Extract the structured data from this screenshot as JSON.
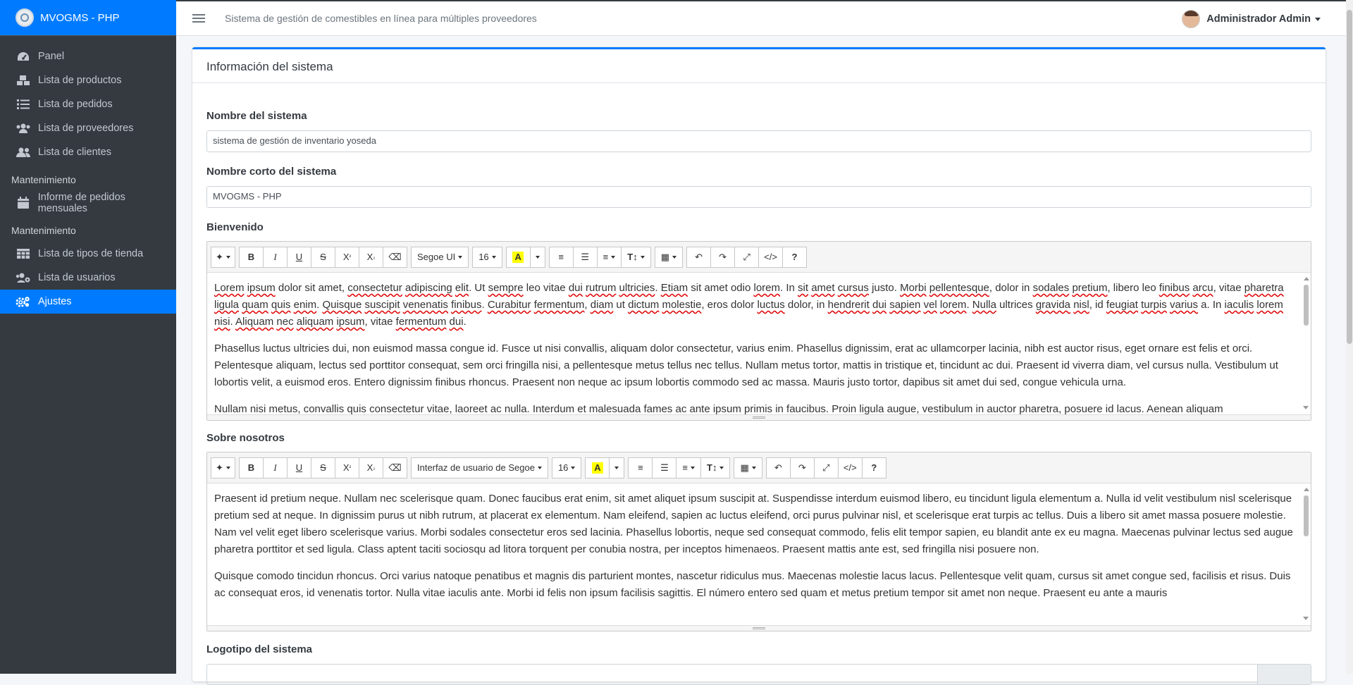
{
  "brand": {
    "title": "MVOGMS - PHP"
  },
  "sidebar": {
    "items": [
      {
        "label": "Panel",
        "icon": "tachometer-icon"
      },
      {
        "label": "Lista de productos",
        "icon": "boxes-icon"
      },
      {
        "label": "Lista de pedidos",
        "icon": "list-icon"
      },
      {
        "label": "Lista de proveedores",
        "icon": "users-icon"
      },
      {
        "label": "Lista de clientes",
        "icon": "user-friends-icon"
      }
    ],
    "header1": "Mantenimiento",
    "report": {
      "label": "Informe de pedidos mensuales",
      "icon": "calendar-icon"
    },
    "header2": "Mantenimiento",
    "items2": [
      {
        "label": "Lista de tipos de tienda",
        "icon": "table-icon"
      },
      {
        "label": "Lista de usuarios",
        "icon": "users-cog-icon"
      },
      {
        "label": "Ajustes",
        "icon": "cogs-icon",
        "active": true
      }
    ]
  },
  "topbar": {
    "system_name": "Sistema de gestión de comestibles en línea para múltiples proveedores",
    "user": "Administrador Admin"
  },
  "card": {
    "title": "Información del sistema"
  },
  "form": {
    "name_label": "Nombre del sistema",
    "name_value": "sistema de gestión de inventario yoseda",
    "short_label": "Nombre corto del sistema",
    "short_value": "MVOGMS - PHP",
    "welcome_label": "Bienvenido",
    "about_label": "Sobre nosotros",
    "logo_label": "Logotipo del sistema"
  },
  "editor1": {
    "font": "Segoe UI",
    "size": "16",
    "paragraphs": [
      "Phasellus luctus ultricies dui, non euismod massa congue id. Fusce ut nisi convallis, aliquam dolor consectetur, varius enim. Phasellus dignissim, erat ac ullamcorper lacinia, nibh est auctor risus, eget ornare est felis et orci. Pelentesque aliquam, lectus sed porttitor consequat, sem orci fringilla nisi, a pellentesque metus tellus nec tellus. Nullam metus tortor, mattis in tristique et, tincidunt ac dui. Praesent id viverra diam, vel cursus nulla. Vestibulum ut lobortis velit, a euismod eros. Entero dignissim finibus rhoncus. Praesent non neque ac ipsum lobortis commodo sed ac massa. Mauris justo tortor, dapibus sit amet dui sed, congue vehicula urna.",
      "Nullam nisi metus, convallis quis consectetur vitae, laoreet ac nulla. Interdum et malesuada fames ac ante ipsum primis in faucibus. Proin ligula augue, vestibulum in auctor pharetra, posuere id lacus. Aenean aliquam"
    ]
  },
  "editor2": {
    "font": "Interfaz de usuario de Segoe",
    "size": "16",
    "paragraphs": [
      "Praesent id pretium neque. Nullam nec scelerisque quam. Donec faucibus erat enim, sit amet aliquet ipsum suscipit at. Suspendisse interdum euismod libero, eu tincidunt ligula elementum a. Nulla id velit vestibulum nisl scelerisque pretium sed at neque. In dignissim purus ut nibh rutrum, at placerat ex elementum. Nam eleifend, sapien ac luctus eleifend, orci purus pulvinar nisl, et scelerisque erat turpis ac tellus. Duis a libero sit amet massa posuere molestie. Nam vel velit eget libero scelerisque varius. Morbi sodales consectetur eros sed lacinia. Phasellus lobortis, neque sed consequat commodo, felis elit tempor sapien, eu blandit ante ex eu magna. Maecenas pulvinar lectus sed augue pharetra porttitor et sed ligula. Class aptent taciti sociosqu ad litora torquent per conubia nostra, per inceptos himenaeos. Praesent mattis ante est, sed fringilla nisi posuere non.",
      "Quisque comodo tincidun rhoncus. Orci varius natoque penatibus et magnis dis parturient montes, nascetur ridiculus mus. Maecenas molestie lacus lacus. Pellentesque velit quam, cursus sit amet congue sed, facilisis et risus. Duis ac consequat eros, id venenatis tortor. Nulla vitae iaculis ante. Morbi id felis non ipsum facilisis sagittis. El número entero sed quam et metus pretium tempor sit amet non neque. Praesent eu ante a mauris"
    ]
  },
  "colors": {
    "primary": "#007bff",
    "sidebar": "#343a40"
  }
}
